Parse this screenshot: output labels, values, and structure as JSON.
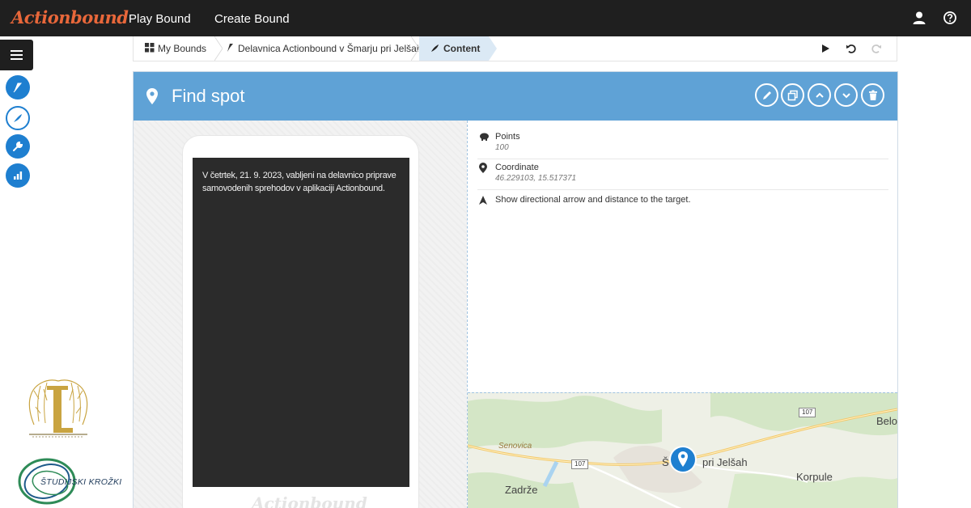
{
  "app": {
    "logo": "Actionbound"
  },
  "nav": {
    "play_bound": "Play Bound",
    "create_bound": "Create Bound"
  },
  "breadcrumb": {
    "my_bounds": "My Bounds",
    "bound_name": "Delavnica Actionbound v Šmarju pri Jelšah",
    "content": "Content"
  },
  "panel": {
    "title": "Find spot",
    "actions": [
      "edit-icon",
      "duplicate-icon",
      "move-up-icon",
      "move-down-icon",
      "delete-icon"
    ]
  },
  "phone": {
    "text": "V četrtek, 21. 9. 2023, vabljeni na delavnico priprave samovodenih sprehodov v aplikaciji Actionbound.",
    "brand": "Actionbound"
  },
  "details": {
    "points_label": "Points",
    "points_value": "100",
    "coordinate_label": "Coordinate",
    "coordinate_value": "46.229103, 15.517371",
    "arrow_text": "Show directional arrow and distance to the target."
  },
  "map": {
    "labels": {
      "senovica": "Senovica",
      "pri_jelsah": "pri Jelšah",
      "korpule": "Korpule",
      "zadrze": "Zadrže",
      "belo": "Belo",
      "s": "Š"
    },
    "roads": {
      "r1": "107",
      "r2": "107"
    }
  },
  "logos": {
    "studijski": "ŠTUDIJSKI KROŽKI"
  },
  "colors": {
    "accent": "#5fa2d6",
    "brand": "#e8673a",
    "topbar": "#1f1f1f",
    "rail_icon": "#1e7fd0"
  }
}
